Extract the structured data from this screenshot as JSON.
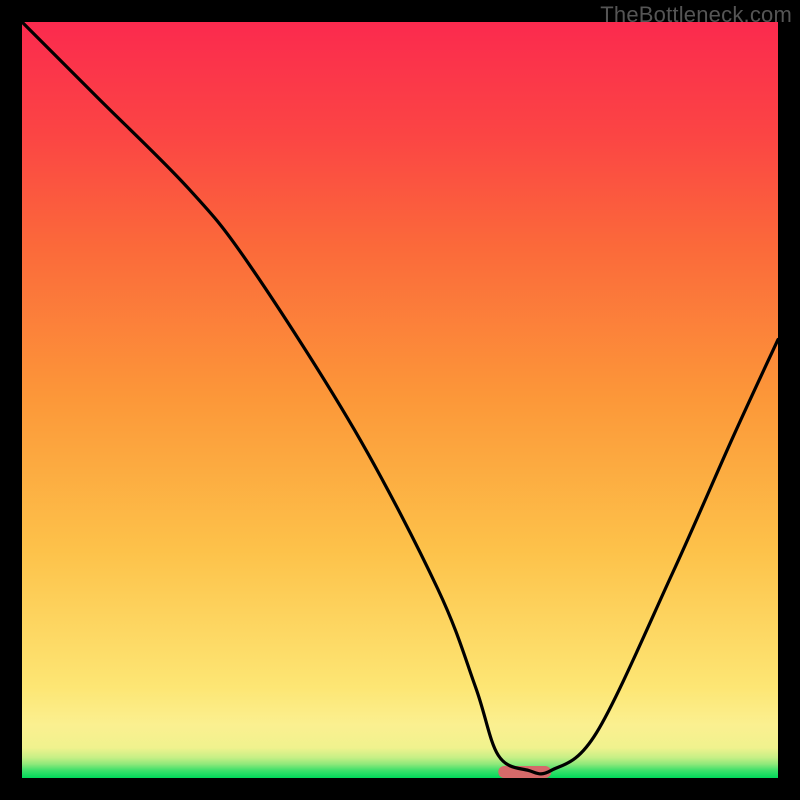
{
  "watermark": "TheBottleneck.com",
  "chart_data": {
    "type": "line",
    "title": "",
    "xlabel": "",
    "ylabel": "",
    "xlim": [
      0,
      100
    ],
    "ylim": [
      0,
      100
    ],
    "grid": false,
    "legend": false,
    "series": [
      {
        "name": "curve",
        "x": [
          0,
          10,
          22,
          30,
          44,
          55,
          60,
          63,
          67,
          70,
          76,
          86,
          94,
          100
        ],
        "y": [
          100,
          90,
          78,
          68,
          46,
          25,
          12,
          3,
          1,
          1,
          6,
          27,
          45,
          58
        ]
      }
    ],
    "marker": {
      "x_start": 63,
      "x_end": 70,
      "y": 0.8,
      "color": "#d66a6a"
    },
    "gradient_stops": [
      {
        "offset": 0.0,
        "color": "#00d85a"
      },
      {
        "offset": 0.01,
        "color": "#3de06a"
      },
      {
        "offset": 0.018,
        "color": "#8ce87a"
      },
      {
        "offset": 0.027,
        "color": "#c6ef86"
      },
      {
        "offset": 0.04,
        "color": "#f0f28e"
      },
      {
        "offset": 0.07,
        "color": "#fbf090"
      },
      {
        "offset": 0.12,
        "color": "#fde674"
      },
      {
        "offset": 0.3,
        "color": "#fdc24a"
      },
      {
        "offset": 0.5,
        "color": "#fc9839"
      },
      {
        "offset": 0.7,
        "color": "#fb6a3a"
      },
      {
        "offset": 0.85,
        "color": "#fb4544"
      },
      {
        "offset": 1.0,
        "color": "#fb2a4e"
      }
    ]
  }
}
